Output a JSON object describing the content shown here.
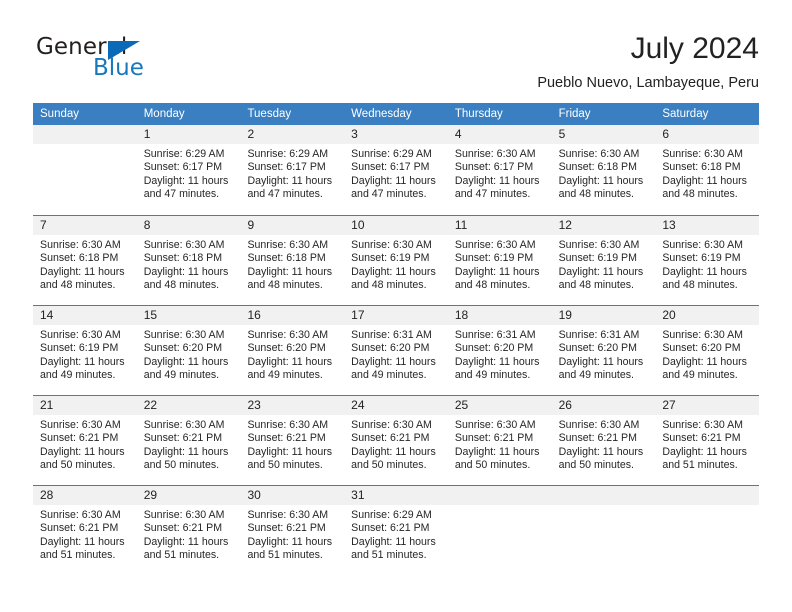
{
  "brand": {
    "word_one": "General",
    "word_two": "Blue",
    "triangle_color": "#0a6ab8",
    "blue_color": "#1878be"
  },
  "header": {
    "title": "July 2024",
    "subtitle": "Pueblo Nuevo, Lambayeque, Peru"
  },
  "theme": {
    "header_blue": "#3a7fc1",
    "daynum_band": "#f1f1f1",
    "text": "#262626"
  },
  "calendar": {
    "weekdays": [
      "Sunday",
      "Monday",
      "Tuesday",
      "Wednesday",
      "Thursday",
      "Friday",
      "Saturday"
    ],
    "weeks": [
      [
        {
          "day": "",
          "sunrise": "",
          "sunset": "",
          "daylight1": "",
          "daylight2": "",
          "empty": true
        },
        {
          "day": "1",
          "sunrise": "Sunrise: 6:29 AM",
          "sunset": "Sunset: 6:17 PM",
          "daylight1": "Daylight: 11 hours",
          "daylight2": "and 47 minutes."
        },
        {
          "day": "2",
          "sunrise": "Sunrise: 6:29 AM",
          "sunset": "Sunset: 6:17 PM",
          "daylight1": "Daylight: 11 hours",
          "daylight2": "and 47 minutes."
        },
        {
          "day": "3",
          "sunrise": "Sunrise: 6:29 AM",
          "sunset": "Sunset: 6:17 PM",
          "daylight1": "Daylight: 11 hours",
          "daylight2": "and 47 minutes."
        },
        {
          "day": "4",
          "sunrise": "Sunrise: 6:30 AM",
          "sunset": "Sunset: 6:17 PM",
          "daylight1": "Daylight: 11 hours",
          "daylight2": "and 47 minutes."
        },
        {
          "day": "5",
          "sunrise": "Sunrise: 6:30 AM",
          "sunset": "Sunset: 6:18 PM",
          "daylight1": "Daylight: 11 hours",
          "daylight2": "and 48 minutes."
        },
        {
          "day": "6",
          "sunrise": "Sunrise: 6:30 AM",
          "sunset": "Sunset: 6:18 PM",
          "daylight1": "Daylight: 11 hours",
          "daylight2": "and 48 minutes."
        }
      ],
      [
        {
          "day": "7",
          "sunrise": "Sunrise: 6:30 AM",
          "sunset": "Sunset: 6:18 PM",
          "daylight1": "Daylight: 11 hours",
          "daylight2": "and 48 minutes."
        },
        {
          "day": "8",
          "sunrise": "Sunrise: 6:30 AM",
          "sunset": "Sunset: 6:18 PM",
          "daylight1": "Daylight: 11 hours",
          "daylight2": "and 48 minutes."
        },
        {
          "day": "9",
          "sunrise": "Sunrise: 6:30 AM",
          "sunset": "Sunset: 6:18 PM",
          "daylight1": "Daylight: 11 hours",
          "daylight2": "and 48 minutes."
        },
        {
          "day": "10",
          "sunrise": "Sunrise: 6:30 AM",
          "sunset": "Sunset: 6:19 PM",
          "daylight1": "Daylight: 11 hours",
          "daylight2": "and 48 minutes."
        },
        {
          "day": "11",
          "sunrise": "Sunrise: 6:30 AM",
          "sunset": "Sunset: 6:19 PM",
          "daylight1": "Daylight: 11 hours",
          "daylight2": "and 48 minutes."
        },
        {
          "day": "12",
          "sunrise": "Sunrise: 6:30 AM",
          "sunset": "Sunset: 6:19 PM",
          "daylight1": "Daylight: 11 hours",
          "daylight2": "and 48 minutes."
        },
        {
          "day": "13",
          "sunrise": "Sunrise: 6:30 AM",
          "sunset": "Sunset: 6:19 PM",
          "daylight1": "Daylight: 11 hours",
          "daylight2": "and 48 minutes."
        }
      ],
      [
        {
          "day": "14",
          "sunrise": "Sunrise: 6:30 AM",
          "sunset": "Sunset: 6:19 PM",
          "daylight1": "Daylight: 11 hours",
          "daylight2": "and 49 minutes."
        },
        {
          "day": "15",
          "sunrise": "Sunrise: 6:30 AM",
          "sunset": "Sunset: 6:20 PM",
          "daylight1": "Daylight: 11 hours",
          "daylight2": "and 49 minutes."
        },
        {
          "day": "16",
          "sunrise": "Sunrise: 6:30 AM",
          "sunset": "Sunset: 6:20 PM",
          "daylight1": "Daylight: 11 hours",
          "daylight2": "and 49 minutes."
        },
        {
          "day": "17",
          "sunrise": "Sunrise: 6:31 AM",
          "sunset": "Sunset: 6:20 PM",
          "daylight1": "Daylight: 11 hours",
          "daylight2": "and 49 minutes."
        },
        {
          "day": "18",
          "sunrise": "Sunrise: 6:31 AM",
          "sunset": "Sunset: 6:20 PM",
          "daylight1": "Daylight: 11 hours",
          "daylight2": "and 49 minutes."
        },
        {
          "day": "19",
          "sunrise": "Sunrise: 6:31 AM",
          "sunset": "Sunset: 6:20 PM",
          "daylight1": "Daylight: 11 hours",
          "daylight2": "and 49 minutes."
        },
        {
          "day": "20",
          "sunrise": "Sunrise: 6:30 AM",
          "sunset": "Sunset: 6:20 PM",
          "daylight1": "Daylight: 11 hours",
          "daylight2": "and 49 minutes."
        }
      ],
      [
        {
          "day": "21",
          "sunrise": "Sunrise: 6:30 AM",
          "sunset": "Sunset: 6:21 PM",
          "daylight1": "Daylight: 11 hours",
          "daylight2": "and 50 minutes."
        },
        {
          "day": "22",
          "sunrise": "Sunrise: 6:30 AM",
          "sunset": "Sunset: 6:21 PM",
          "daylight1": "Daylight: 11 hours",
          "daylight2": "and 50 minutes."
        },
        {
          "day": "23",
          "sunrise": "Sunrise: 6:30 AM",
          "sunset": "Sunset: 6:21 PM",
          "daylight1": "Daylight: 11 hours",
          "daylight2": "and 50 minutes."
        },
        {
          "day": "24",
          "sunrise": "Sunrise: 6:30 AM",
          "sunset": "Sunset: 6:21 PM",
          "daylight1": "Daylight: 11 hours",
          "daylight2": "and 50 minutes."
        },
        {
          "day": "25",
          "sunrise": "Sunrise: 6:30 AM",
          "sunset": "Sunset: 6:21 PM",
          "daylight1": "Daylight: 11 hours",
          "daylight2": "and 50 minutes."
        },
        {
          "day": "26",
          "sunrise": "Sunrise: 6:30 AM",
          "sunset": "Sunset: 6:21 PM",
          "daylight1": "Daylight: 11 hours",
          "daylight2": "and 50 minutes."
        },
        {
          "day": "27",
          "sunrise": "Sunrise: 6:30 AM",
          "sunset": "Sunset: 6:21 PM",
          "daylight1": "Daylight: 11 hours",
          "daylight2": "and 51 minutes."
        }
      ],
      [
        {
          "day": "28",
          "sunrise": "Sunrise: 6:30 AM",
          "sunset": "Sunset: 6:21 PM",
          "daylight1": "Daylight: 11 hours",
          "daylight2": "and 51 minutes."
        },
        {
          "day": "29",
          "sunrise": "Sunrise: 6:30 AM",
          "sunset": "Sunset: 6:21 PM",
          "daylight1": "Daylight: 11 hours",
          "daylight2": "and 51 minutes."
        },
        {
          "day": "30",
          "sunrise": "Sunrise: 6:30 AM",
          "sunset": "Sunset: 6:21 PM",
          "daylight1": "Daylight: 11 hours",
          "daylight2": "and 51 minutes."
        },
        {
          "day": "31",
          "sunrise": "Sunrise: 6:29 AM",
          "sunset": "Sunset: 6:21 PM",
          "daylight1": "Daylight: 11 hours",
          "daylight2": "and 51 minutes."
        },
        {
          "day": "",
          "sunrise": "",
          "sunset": "",
          "daylight1": "",
          "daylight2": "",
          "empty": true
        },
        {
          "day": "",
          "sunrise": "",
          "sunset": "",
          "daylight1": "",
          "daylight2": "",
          "empty": true
        },
        {
          "day": "",
          "sunrise": "",
          "sunset": "",
          "daylight1": "",
          "daylight2": "",
          "empty": true
        }
      ]
    ]
  }
}
